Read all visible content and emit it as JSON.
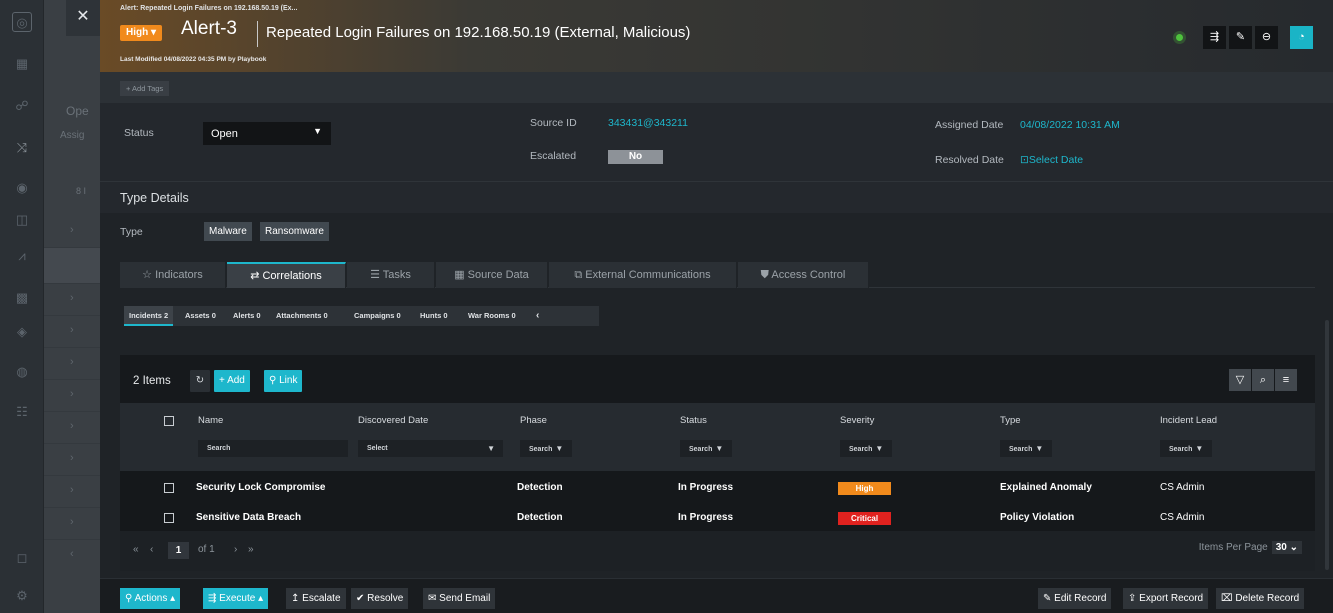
{
  "background": {
    "panel_label_1": "Ope",
    "panel_label_2": "Assig",
    "panel_count": "8 I"
  },
  "header": {
    "breadcrumb": "Alert: Repeated Login Failures on 192.168.50.19 (Ex...",
    "severity": "High",
    "alert_id": "Alert-3",
    "title": "Repeated Login Failures on 192.168.50.19 (External, Malicious)",
    "last_modified": "Last Modified 04/08/2022 04:35 PM by Playbook"
  },
  "tags": {
    "add_label": "+ Add Tags"
  },
  "fields": {
    "status_label": "Status",
    "status_value": "Open",
    "source_id_label": "Source ID",
    "source_id_value": "343431@343211",
    "escalated_label": "Escalated",
    "escalated_value": "No",
    "assigned_date_label": "Assigned Date",
    "assigned_date_value": "04/08/2022 10:31 AM",
    "resolved_date_label": "Resolved Date",
    "resolved_date_value": "Select Date"
  },
  "type_details": {
    "heading": "Type Details",
    "type_label": "Type",
    "types": [
      "Malware",
      "Ransomware"
    ]
  },
  "tabs": [
    {
      "label": "Indicators",
      "icon": "star-icon"
    },
    {
      "label": "Correlations",
      "icon": "arrows-icon"
    },
    {
      "label": "Tasks",
      "icon": "list-icon"
    },
    {
      "label": "Source Data",
      "icon": "grid-icon"
    },
    {
      "label": "External Communications",
      "icon": "comm-icon"
    },
    {
      "label": "Access Control",
      "icon": "shield-icon"
    }
  ],
  "subtabs": [
    {
      "label": "Incidents",
      "count": "2"
    },
    {
      "label": "Assets",
      "count": "0"
    },
    {
      "label": "Alerts",
      "count": "0"
    },
    {
      "label": "Attachments",
      "count": "0"
    },
    {
      "label": "Campaigns",
      "count": "0"
    },
    {
      "label": "Hunts",
      "count": "0"
    },
    {
      "label": "War Rooms",
      "count": "0"
    }
  ],
  "grid": {
    "items_count": "2 Items",
    "add_label": "+ Add",
    "link_label": "Link",
    "columns": [
      "Name",
      "Discovered Date",
      "Phase",
      "Status",
      "Severity",
      "Type",
      "Incident Lead"
    ],
    "filters": {
      "name": "Search",
      "discovered_date": "Select",
      "phase": "Search",
      "status": "Search",
      "severity": "Search",
      "type": "Search",
      "incident_lead": "Search"
    },
    "rows": [
      {
        "name": "Security Lock Compromise",
        "discovered_date": "",
        "phase": "Detection",
        "status": "In Progress",
        "severity": "High",
        "severity_color": "#f18a1c",
        "type": "Explained Anomaly",
        "lead": "CS Admin"
      },
      {
        "name": "Sensitive Data Breach",
        "discovered_date": "",
        "phase": "Detection",
        "status": "In Progress",
        "severity": "Critical",
        "severity_color": "#e0221f",
        "type": "Policy Violation",
        "lead": "CS Admin"
      }
    ]
  },
  "pager": {
    "first": "«",
    "prev": "‹",
    "current": "1",
    "of": "of 1",
    "next": "›",
    "last": "»",
    "items_per_page_label": "Items Per Page",
    "items_per_page_value": "30"
  },
  "footer": {
    "actions": "Actions",
    "execute": "Execute",
    "escalate": "Escalate",
    "resolve": "Resolve",
    "send_email": "Send Email",
    "edit_record": "Edit Record",
    "export_record": "Export Record",
    "delete_record": "Delete Record"
  },
  "colors": {
    "accent": "#1eb7cc",
    "high": "#f18a1c",
    "critical": "#e0221f",
    "status_ok": "#4ec23d"
  }
}
